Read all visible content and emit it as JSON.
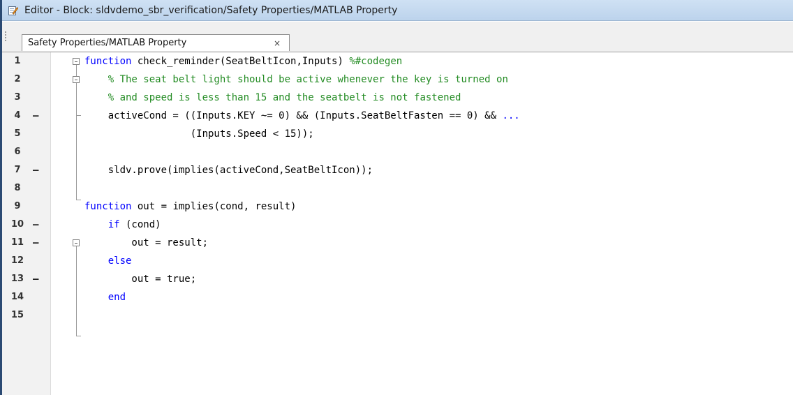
{
  "window": {
    "title": "Editor - Block: sldvdemo_sbr_verification/Safety Properties/MATLAB Property",
    "title_icon": "edit-icon"
  },
  "tabs": [
    {
      "label": "Safety Properties/MATLAB Property",
      "close_glyph": "×"
    }
  ],
  "editor": {
    "lines": [
      {
        "num": "1",
        "dash": "",
        "html": "<span class=\"kw\">function</span> check_reminder(SeatBeltIcon,Inputs) <span class=\"cm\">%#codegen</span>"
      },
      {
        "num": "2",
        "dash": "",
        "html": "    <span class=\"cm\">% The seat belt light should be active whenever the key is turned on</span>"
      },
      {
        "num": "3",
        "dash": "",
        "html": "    <span class=\"cm\">% and speed is less than 15 and the seatbelt is not fastened</span>"
      },
      {
        "num": "4",
        "dash": "–",
        "html": "    activeCond = ((Inputs.KEY ~= 0) &amp;&amp; (Inputs.SeatBeltFasten == 0) &amp;&amp; <span class=\"kw\">...</span>"
      },
      {
        "num": "5",
        "dash": "",
        "html": "                  (Inputs.Speed &lt; 15));"
      },
      {
        "num": "6",
        "dash": "",
        "html": ""
      },
      {
        "num": "7",
        "dash": "–",
        "html": "    sldv.prove(implies(activeCond,SeatBeltIcon));"
      },
      {
        "num": "8",
        "dash": "",
        "html": ""
      },
      {
        "num": "9",
        "dash": "",
        "html": "<span class=\"kw\">function</span> out = implies(cond, result)"
      },
      {
        "num": "10",
        "dash": "–",
        "html": "    <span class=\"kw\">if</span> (cond)"
      },
      {
        "num": "11",
        "dash": "–",
        "html": "        out = result;"
      },
      {
        "num": "12",
        "dash": "",
        "html": "    <span class=\"kw\">else</span>"
      },
      {
        "num": "13",
        "dash": "–",
        "html": "        out = true;"
      },
      {
        "num": "14",
        "dash": "",
        "html": "    <span class=\"kw\">end</span>"
      },
      {
        "num": "15",
        "dash": "",
        "html": ""
      }
    ]
  },
  "colors": {
    "keyword": "#0000ff",
    "comment": "#228b22",
    "titlebar": "#bcd3ec"
  }
}
